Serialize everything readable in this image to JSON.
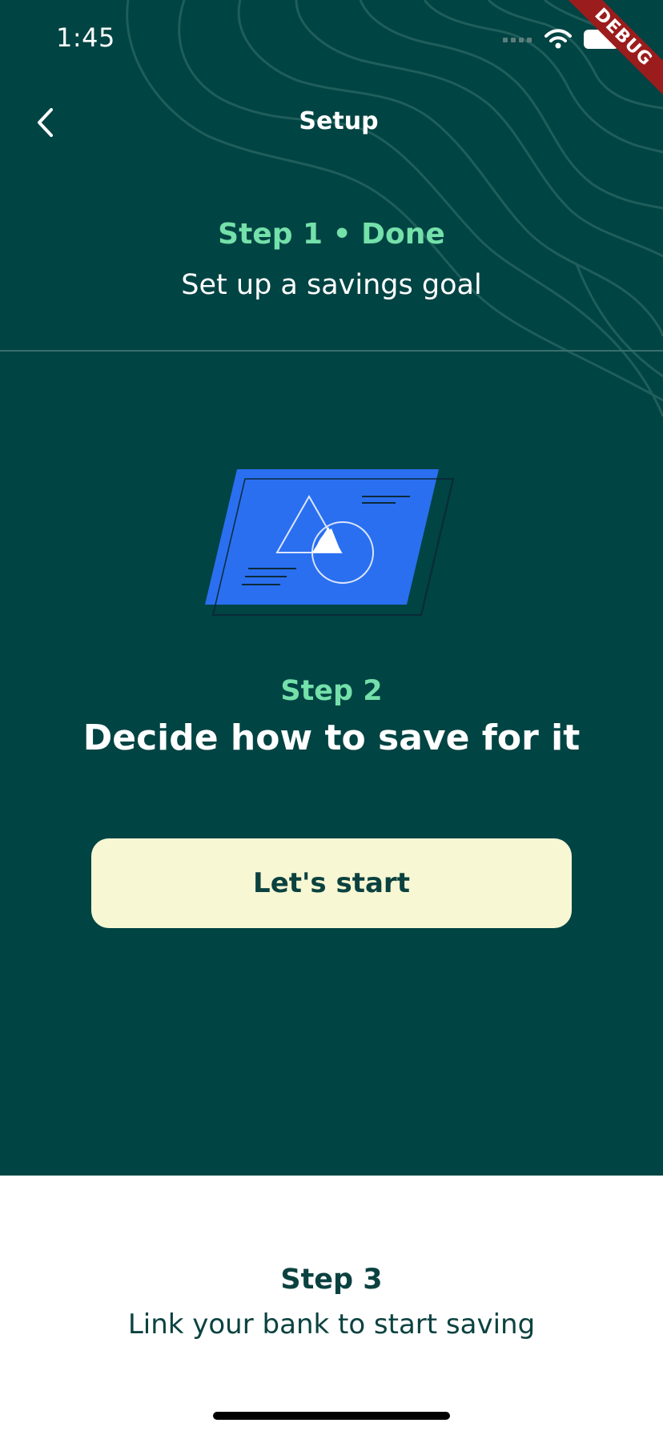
{
  "status_bar": {
    "time": "1:45",
    "debug_label": "DEBUG"
  },
  "nav": {
    "title": "Setup",
    "back_icon": "chevron-left-icon"
  },
  "step1": {
    "label": "Step 1 • Done",
    "description": "Set up a savings goal"
  },
  "step2": {
    "label": "Step 2",
    "title": "Decide how to save for it",
    "button_label": "Let's start"
  },
  "step3": {
    "label": "Step 3",
    "description": "Link your bank to start saving"
  },
  "colors": {
    "background_dark": "#004443",
    "accent_green": "#74e0aa",
    "button_bg": "#f7f7d3",
    "text_dark": "#0b4240",
    "illustration_blue": "#2a6ff0",
    "debug_ribbon": "#9b1c1c"
  }
}
